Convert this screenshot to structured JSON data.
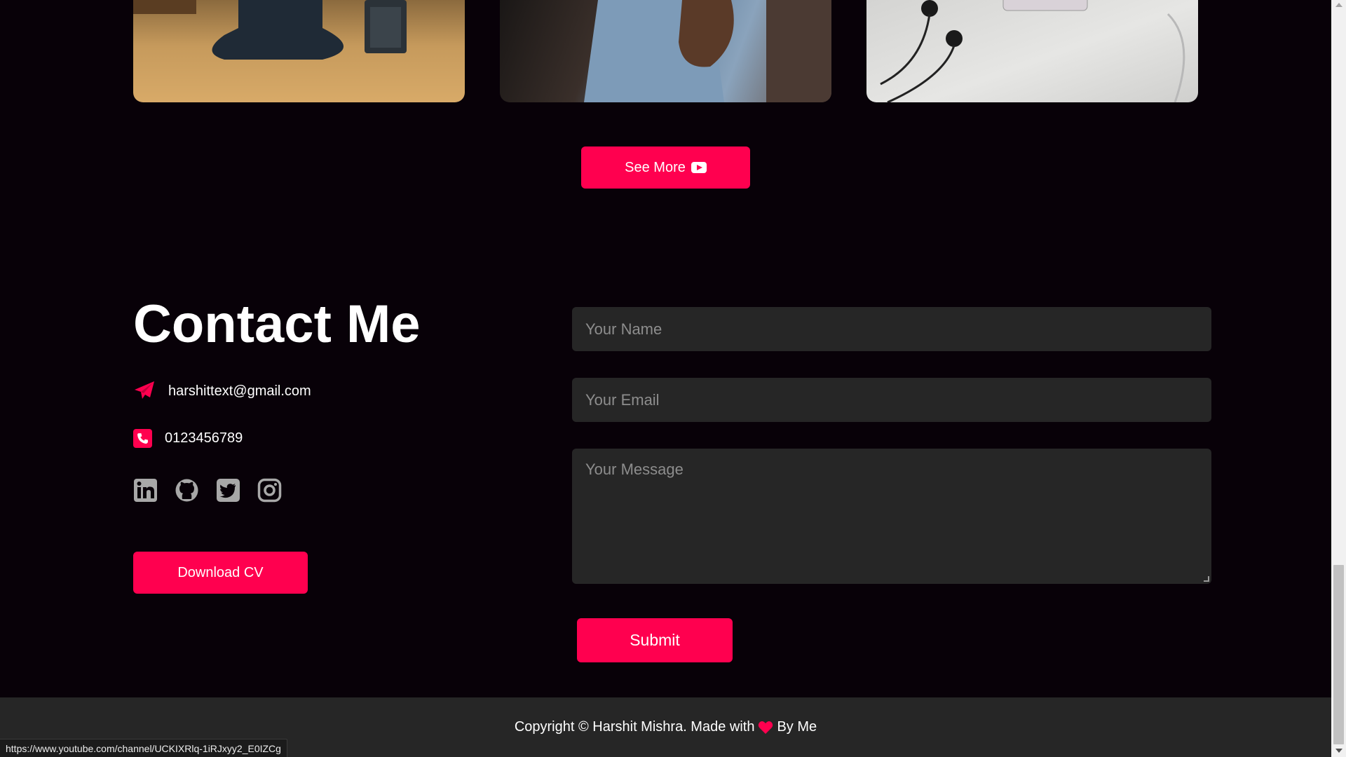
{
  "portfolio": {
    "cards": [
      {
        "name": "desk-photo"
      },
      {
        "name": "person-photo"
      },
      {
        "name": "earphones-photo"
      }
    ],
    "see_more_label": "See More"
  },
  "contact": {
    "title": "Contact Me",
    "email": "harshittext@gmail.com",
    "phone": "0123456789",
    "socials": [
      "linkedin-icon",
      "github-icon",
      "twitter-icon",
      "instagram-icon"
    ],
    "download_cv_label": "Download CV"
  },
  "form": {
    "name_placeholder": "Your Name",
    "email_placeholder": "Your Email",
    "message_placeholder": "Your Message",
    "submit_label": "Submit"
  },
  "footer": {
    "text_before": "Copyright © Harshit Mishra. Made with",
    "text_after": "By Me"
  },
  "status_bar": {
    "url": "https://www.youtube.com/channel/UCKIXRlq-1iRJxyy2_E0IZCg"
  },
  "colors": {
    "accent": "#ff004f",
    "background": "#080108",
    "field_bg": "#262626"
  }
}
